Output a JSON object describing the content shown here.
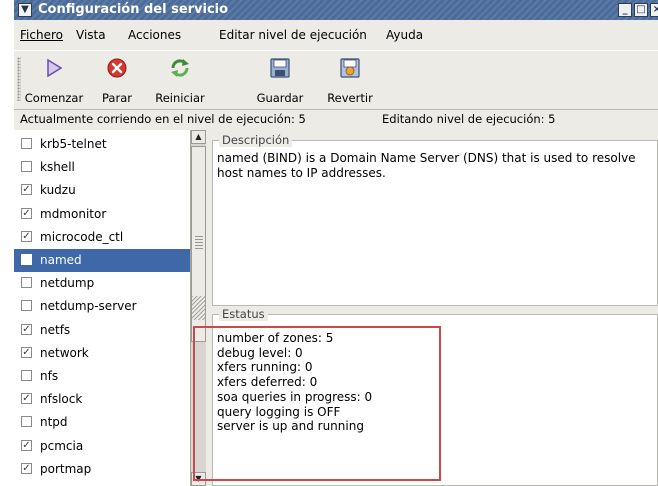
{
  "window": {
    "title": "Configuración del servicio"
  },
  "menubar": {
    "items": [
      {
        "label": "Fichero"
      },
      {
        "label": "Vista"
      },
      {
        "label": "Acciones"
      },
      {
        "label": "Editar nivel de ejecución"
      },
      {
        "label": "Ayuda"
      }
    ]
  },
  "toolbar": {
    "start": {
      "label": "Comenzar",
      "icon": "play-icon"
    },
    "stop": {
      "label": "Parar",
      "icon": "stop-icon"
    },
    "restart": {
      "label": "Reiniciar",
      "icon": "restart-icon"
    },
    "save": {
      "label": "Guardar",
      "icon": "save-icon"
    },
    "revert": {
      "label": "Revertir",
      "icon": "revert-icon"
    }
  },
  "status": {
    "current": "Actualmente corriendo en el nivel de ejecución: 5",
    "editing": "Editando nivel de ejecución: 5"
  },
  "services": [
    {
      "name": "krb5-telnet",
      "checked": false
    },
    {
      "name": "kshell",
      "checked": false
    },
    {
      "name": "kudzu",
      "checked": true
    },
    {
      "name": "mdmonitor",
      "checked": true
    },
    {
      "name": "microcode_ctl",
      "checked": true
    },
    {
      "name": "named",
      "checked": false,
      "selected": true
    },
    {
      "name": "netdump",
      "checked": false
    },
    {
      "name": "netdump-server",
      "checked": false
    },
    {
      "name": "netfs",
      "checked": true
    },
    {
      "name": "network",
      "checked": true
    },
    {
      "name": "nfs",
      "checked": false
    },
    {
      "name": "nfslock",
      "checked": true
    },
    {
      "name": "ntpd",
      "checked": false
    },
    {
      "name": "pcmcia",
      "checked": true
    },
    {
      "name": "portmap",
      "checked": true
    }
  ],
  "description": {
    "label": "Descripción",
    "text": "named (BIND) is a Domain Name Server (DNS) that is used to resolve host names to IP addresses."
  },
  "estatus": {
    "label": "Estatus",
    "lines": [
      "number of zones: 5",
      "debug level: 0",
      "xfers running: 0",
      "xfers deferred: 0",
      "soa queries in progress: 0",
      "query logging is OFF",
      "server is up and running"
    ]
  },
  "colors": {
    "titlebar": "#4b6b9a",
    "selection": "#3e68a8",
    "annotation": "#c94a4a"
  }
}
